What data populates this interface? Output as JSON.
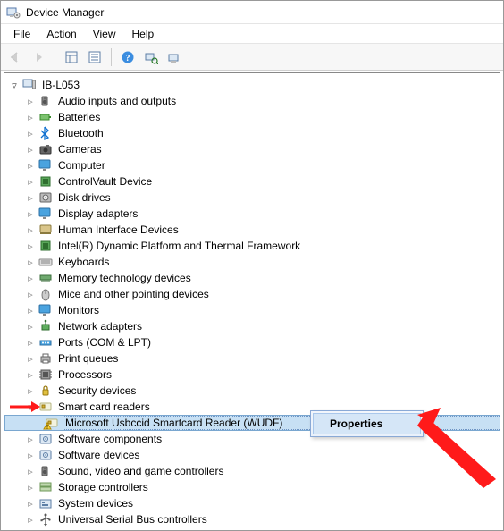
{
  "window": {
    "title": "Device Manager"
  },
  "menu": {
    "file": "File",
    "action": "Action",
    "view": "View",
    "help": "Help"
  },
  "tree": {
    "root": "IB-L053",
    "items": [
      {
        "label": "Audio inputs and outputs",
        "icon": "speaker"
      },
      {
        "label": "Batteries",
        "icon": "battery"
      },
      {
        "label": "Bluetooth",
        "icon": "bluetooth"
      },
      {
        "label": "Cameras",
        "icon": "camera"
      },
      {
        "label": "Computer",
        "icon": "monitor"
      },
      {
        "label": "ControlVault Device",
        "icon": "chip"
      },
      {
        "label": "Disk drives",
        "icon": "disk"
      },
      {
        "label": "Display adapters",
        "icon": "monitor"
      },
      {
        "label": "Human Interface Devices",
        "icon": "hid"
      },
      {
        "label": "Intel(R) Dynamic Platform and Thermal Framework",
        "icon": "chip"
      },
      {
        "label": "Keyboards",
        "icon": "keyboard"
      },
      {
        "label": "Memory technology devices",
        "icon": "memory"
      },
      {
        "label": "Mice and other pointing devices",
        "icon": "mouse"
      },
      {
        "label": "Monitors",
        "icon": "monitor"
      },
      {
        "label": "Network adapters",
        "icon": "network"
      },
      {
        "label": "Ports (COM & LPT)",
        "icon": "port"
      },
      {
        "label": "Print queues",
        "icon": "printer"
      },
      {
        "label": "Processors",
        "icon": "cpu"
      },
      {
        "label": "Security devices",
        "icon": "security"
      },
      {
        "label": "Smart card readers",
        "icon": "smartcard",
        "expanded": true,
        "children": [
          {
            "label": "Microsoft Usbccid Smartcard Reader (WUDF)",
            "icon": "smartcard",
            "warn": true,
            "selected": true
          }
        ]
      },
      {
        "label": "Software components",
        "icon": "software"
      },
      {
        "label": "Software devices",
        "icon": "software"
      },
      {
        "label": "Sound, video and game controllers",
        "icon": "speaker"
      },
      {
        "label": "Storage controllers",
        "icon": "storage"
      },
      {
        "label": "System devices",
        "icon": "system"
      },
      {
        "label": "Universal Serial Bus controllers",
        "icon": "usb"
      }
    ]
  },
  "context_menu": {
    "properties": "Properties"
  },
  "colors": {
    "selection": "#c7e0f4",
    "annotation": "#ff1a1a"
  }
}
